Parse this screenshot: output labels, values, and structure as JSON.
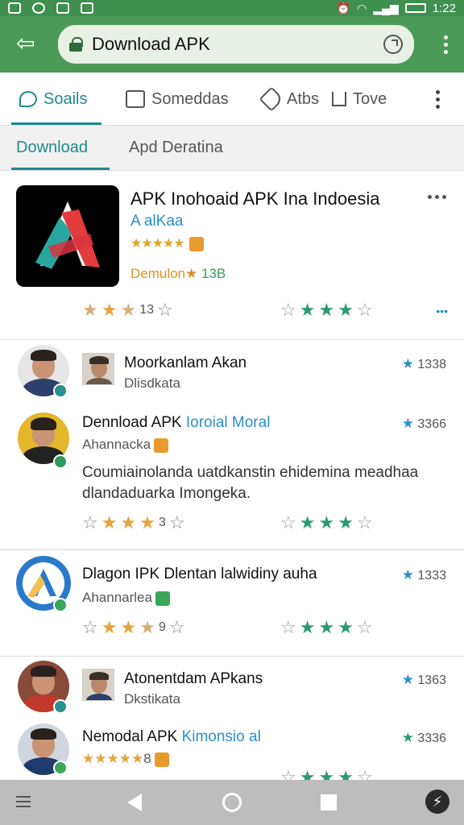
{
  "status_bar": {
    "time": "1:22"
  },
  "app_bar": {
    "url": "Download APK"
  },
  "tabs_primary": [
    {
      "label": "Soails"
    },
    {
      "label": "Someddas"
    },
    {
      "label": "Atbs"
    },
    {
      "label": "Tove"
    }
  ],
  "tabs_secondary": [
    {
      "label": "Download"
    },
    {
      "label": "Apd Deratina"
    }
  ],
  "app": {
    "title": "APK Inohoaid APK Ina Indoesia",
    "subtitle": "A alKaa",
    "rating_stars": "★★★★★",
    "downloads_label": "Demulon★",
    "downloads_count": "13B",
    "rating_left_count": "13",
    "rating_left_value": 3,
    "rating_right_value": 3
  },
  "reviews": [
    {
      "name": "Moorkanlam Akan",
      "sub": "Dlisdkata",
      "count": "1338"
    },
    {
      "name_main": "Dennload APK ",
      "name_highlight": "Ioroial Moral",
      "sub": "Ahannacka",
      "count": "3366",
      "body": "Coumiainolanda uatdkanstin ehidemina meadhaa dlandaduarka Imongeka.",
      "rating_left_count": "3",
      "rating_left_value": 4,
      "rating_right_value": 3,
      "badge_color": "#e89a2c"
    },
    {
      "name": "Dlagon IPK Dlentan lalwidiny auha",
      "sub": "Ahannarlea",
      "count": "1333",
      "rating_left_count": "9",
      "rating_left_value": 3,
      "rating_right_value": 3,
      "badge_color": "#3aa65a"
    },
    {
      "name": "Atonentdam APkans",
      "sub": "Dkstikata",
      "count": "1363"
    },
    {
      "name_main": "Nemodal APK ",
      "name_highlight": "Kimonsio al",
      "sub_stars": "★★★★★",
      "sub_count": "8",
      "count": "3336",
      "badge_color": "#e89a2c"
    }
  ],
  "colors": {
    "status_bar": "#3f8f4e",
    "app_bar": "#4c9a57",
    "accent": "#1f8a8a",
    "link_blue": "#2a8fc9",
    "star_orange": "#e5a43a",
    "star_teal": "#2b9a70"
  },
  "icons": {
    "back": "back-arrow-icon",
    "lock": "lock-icon",
    "reload": "reload-icon",
    "menu": "overflow-menu-icon"
  }
}
